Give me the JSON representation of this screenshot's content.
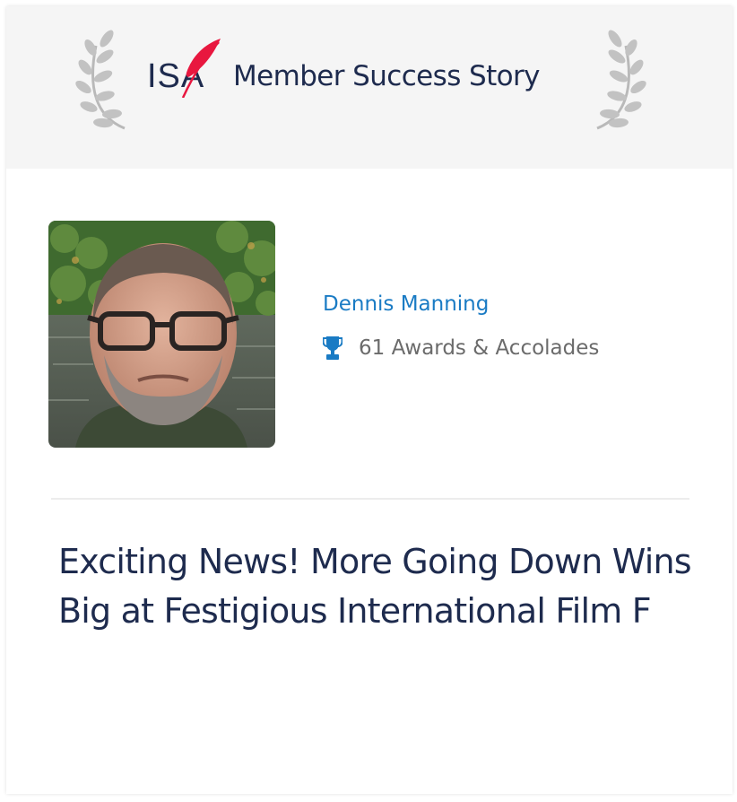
{
  "header": {
    "logo_text": "ISA",
    "title": "Member Success Story"
  },
  "member": {
    "name": "Dennis Manning",
    "awards_icon": "trophy-icon",
    "awards_text": "61 Awards & Accolades"
  },
  "story": {
    "headline": "Exciting News! More Going Down Wins Big at Festigious International Film F"
  },
  "colors": {
    "header_bg": "#f5f5f5",
    "navy": "#1e2b4e",
    "link_blue": "#1a7bc4",
    "logo_red": "#e8173f",
    "muted_text": "#6b6b6b",
    "laurel_gray": "#b9b9b9"
  }
}
